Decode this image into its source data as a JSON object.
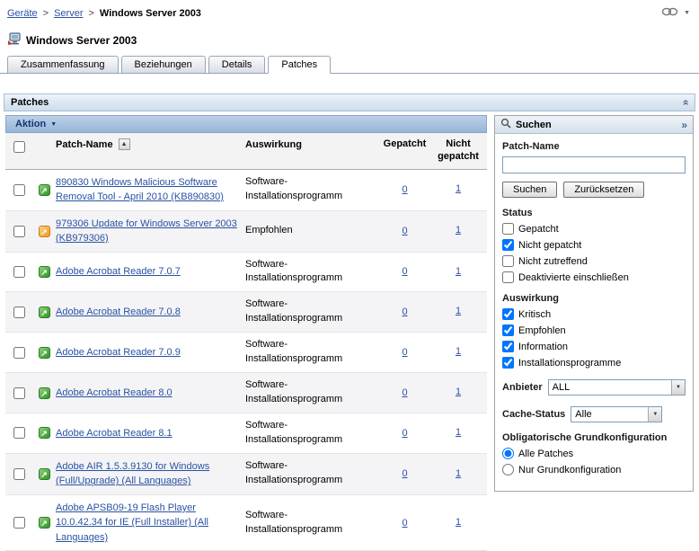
{
  "colors": {
    "link": "#2a52a2",
    "action_bar_text": "#14386e",
    "alt_row_bg": "#f4f4f6"
  },
  "breadcrumb": {
    "separator": ">",
    "items": [
      {
        "label": "Geräte"
      },
      {
        "label": "Server"
      },
      {
        "label": "Windows Server 2003"
      }
    ]
  },
  "page": {
    "title": "Windows Server 2003"
  },
  "tabs": [
    {
      "label": "Zusammenfassung",
      "active": false
    },
    {
      "label": "Beziehungen",
      "active": false
    },
    {
      "label": "Details",
      "active": false
    },
    {
      "label": "Patches",
      "active": true
    }
  ],
  "panel": {
    "title": "Patches"
  },
  "table": {
    "action_menu_label": "Aktion",
    "columns": {
      "name": "Patch-Name",
      "impact": "Auswirkung",
      "patched": "Gepatcht",
      "not_patched": "Nicht gepatcht"
    },
    "rows": [
      {
        "icon": "green",
        "name": "890830 Windows Malicious Software Removal Tool - April 2010 (KB890830)",
        "impact": "Software-Installationsprogramm",
        "patched": "0",
        "not_patched": "1"
      },
      {
        "icon": "orange",
        "name": "979306 Update for Windows Server 2003 (KB979306)",
        "impact": "Empfohlen",
        "patched": "0",
        "not_patched": "1"
      },
      {
        "icon": "green",
        "name": "Adobe Acrobat Reader 7.0.7",
        "impact": "Software-Installationsprogramm",
        "patched": "0",
        "not_patched": "1"
      },
      {
        "icon": "green",
        "name": "Adobe Acrobat Reader 7.0.8",
        "impact": "Software-Installationsprogramm",
        "patched": "0",
        "not_patched": "1"
      },
      {
        "icon": "green",
        "name": "Adobe Acrobat Reader 7.0.9",
        "impact": "Software-Installationsprogramm",
        "patched": "0",
        "not_patched": "1"
      },
      {
        "icon": "green",
        "name": "Adobe Acrobat Reader 8.0",
        "impact": "Software-Installationsprogramm",
        "patched": "0",
        "not_patched": "1"
      },
      {
        "icon": "green",
        "name": "Adobe Acrobat Reader 8.1",
        "impact": "Software-Installationsprogramm",
        "patched": "0",
        "not_patched": "1"
      },
      {
        "icon": "green",
        "name": "Adobe AIR 1.5.3.9130 for Windows (Full/Upgrade) (All Languages)",
        "impact": "Software-Installationsprogramm",
        "patched": "0",
        "not_patched": "1"
      },
      {
        "icon": "green",
        "name": "Adobe APSB09-19 Flash Player 10.0.42.34 for IE (Full Installer) (All Languages)",
        "impact": "Software-Installationsprogramm",
        "patched": "0",
        "not_patched": "1"
      }
    ]
  },
  "search": {
    "title": "Suchen",
    "patch_name_label": "Patch-Name",
    "patch_name_value": "",
    "search_button_label": "Suchen",
    "reset_button_label": "Zurücksetzen",
    "status_section": {
      "label": "Status",
      "options": [
        {
          "label": "Gepatcht",
          "checked": false
        },
        {
          "label": "Nicht gepatcht",
          "checked": true
        },
        {
          "label": "Nicht zutreffend",
          "checked": false
        },
        {
          "label": "Deaktivierte einschließen",
          "checked": false
        }
      ]
    },
    "impact_section": {
      "label": "Auswirkung",
      "options": [
        {
          "label": "Kritisch",
          "checked": true
        },
        {
          "label": "Empfohlen",
          "checked": true
        },
        {
          "label": "Information",
          "checked": true
        },
        {
          "label": "Installationsprogramme",
          "checked": true
        }
      ]
    },
    "vendor": {
      "label": "Anbieter",
      "value": "ALL"
    },
    "cache_status": {
      "label": "Cache-Status",
      "value": "Alle"
    },
    "baseline_section": {
      "label": "Obligatorische Grundkonfiguration",
      "options": [
        {
          "label": "Alle Patches",
          "selected": true
        },
        {
          "label": "Nur Grundkonfiguration",
          "selected": false
        }
      ]
    }
  }
}
